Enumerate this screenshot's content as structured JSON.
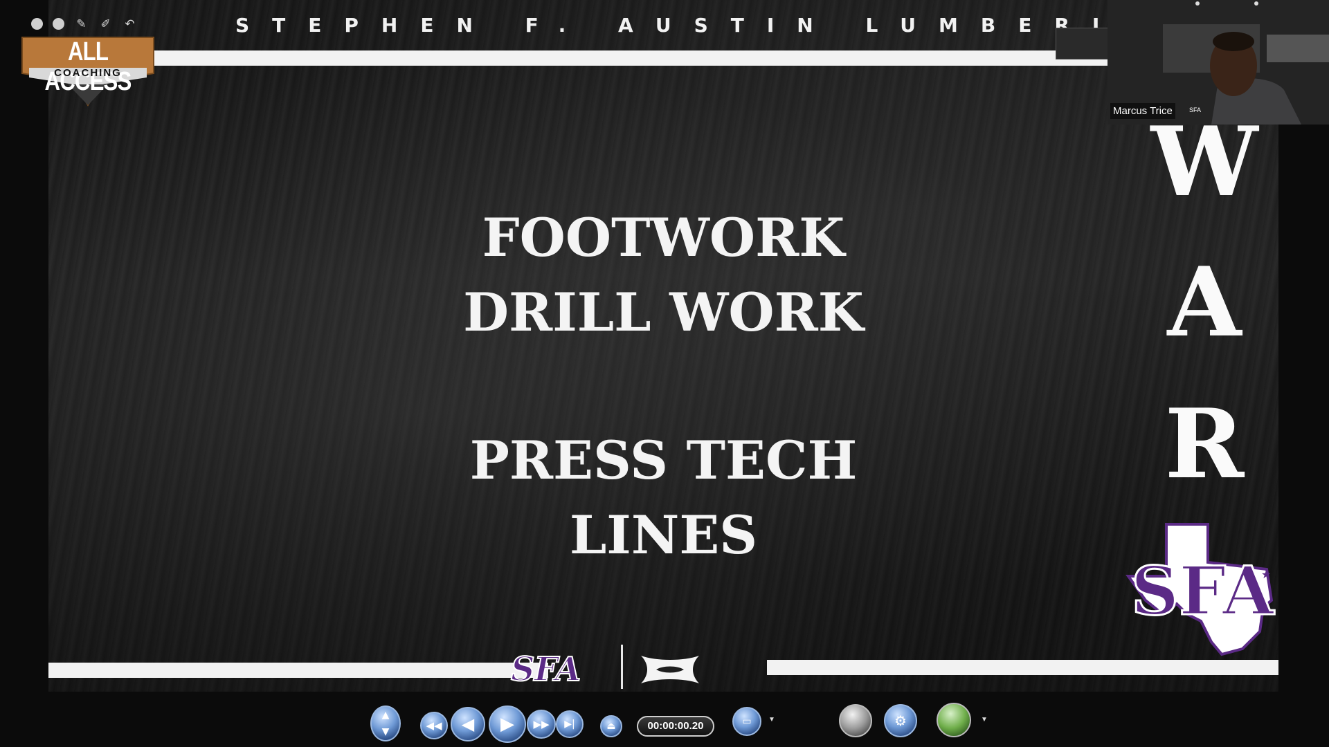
{
  "slide": {
    "banner_text": "STEPHEN F. AUSTIN LUMBERJACKS",
    "title_block_1": [
      "FOOTWORK",
      "DRILL WORK"
    ],
    "title_block_2": [
      "PRESS TECH",
      "LINES"
    ],
    "vertical_word": [
      "W",
      "A",
      "R"
    ],
    "bottom_logo_text": "SFA",
    "state_logo_text": "SFA"
  },
  "overlay_logo": {
    "title": "ALL ACCESS",
    "subtitle": "COACHING",
    "accent_color": "#b8783a"
  },
  "webcam": {
    "participant_name": "Marcus Trice"
  },
  "player": {
    "time": "00:00:00.20",
    "controls": [
      "scroll-button",
      "rewind-button",
      "previous-frame-button",
      "play-button",
      "fast-forward-button",
      "next-frame-button",
      "eject-button",
      "display-menu-button",
      "snapshot-button",
      "settings-button",
      "hd-menu-button"
    ]
  },
  "colors": {
    "sfa_purple": "#5b2a86",
    "control_blue": "#6f9ad6"
  },
  "icons": [
    "circle-icon",
    "circle-icon",
    "pen-icon",
    "marker-icon",
    "undo-icon"
  ]
}
